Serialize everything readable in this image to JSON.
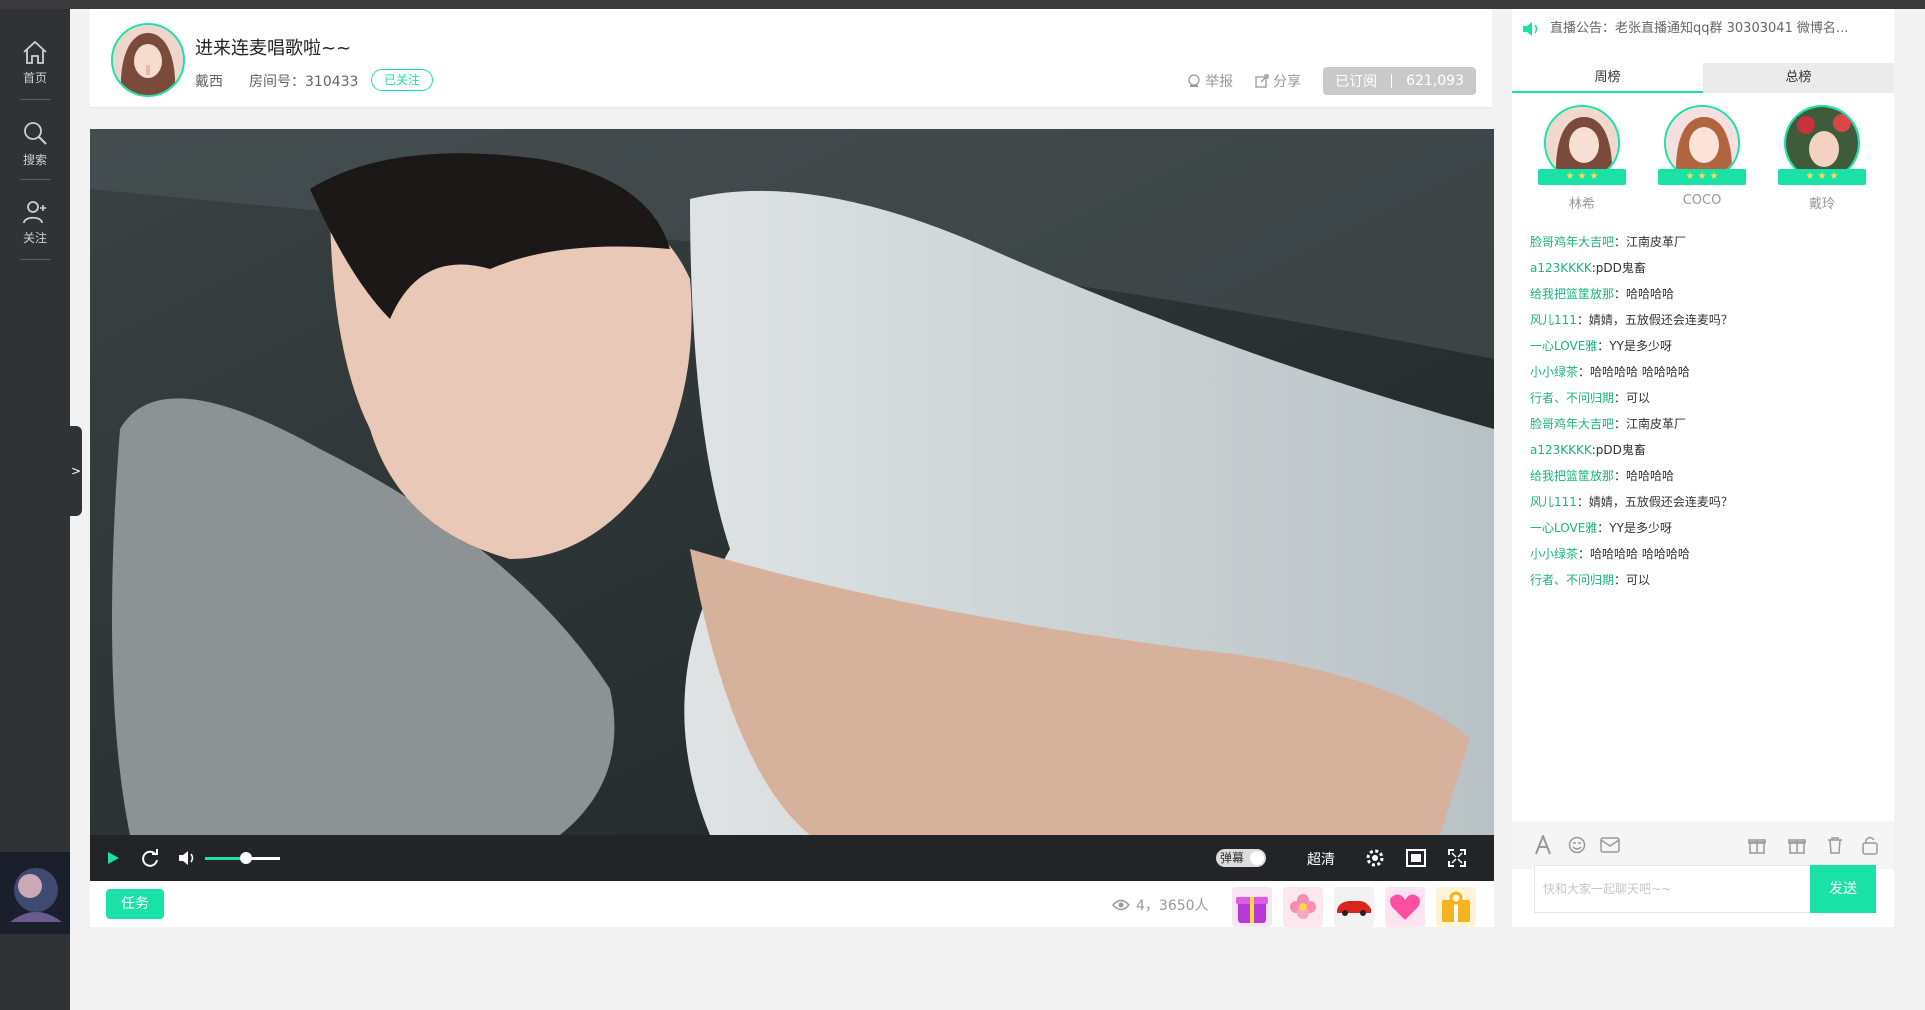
{
  "nav": {
    "home": "首页",
    "search": "搜索",
    "follow": "关注",
    "expand": ">"
  },
  "header": {
    "title": "进来连麦唱歌啦~~",
    "streamer": "戴西",
    "room": "房间号：310433",
    "follow_status": "已关注",
    "report": "举报",
    "share": "分享",
    "subscribed": "已订阅",
    "subscriber_count": "621,093"
  },
  "player": {
    "danmu": "弹幕",
    "quality": "超清",
    "volume_level": 0.55,
    "task": "任务",
    "viewers": "4，3650人"
  },
  "gifts": [
    "gift-box-icon",
    "flower-icon",
    "car-icon",
    "heart-icon",
    "present-icon"
  ],
  "panel": {
    "announcement": "直播公告：老张直播通知qq群 30303041 微博名...",
    "tabs": [
      "周榜",
      "总榜"
    ],
    "ranking": [
      {
        "name": "林希"
      },
      {
        "name": "COCO"
      },
      {
        "name": "戴玲"
      }
    ],
    "chat": [
      {
        "user": "脸哥鸡年大吉吧",
        "text": "：江南皮革厂"
      },
      {
        "user": "a123KKKK",
        "text": ":pDD鬼畜"
      },
      {
        "user": "给我把篮筐放那",
        "text": "：哈哈哈哈"
      },
      {
        "user": "风儿111",
        "text": "：婧婧，五放假还会连麦吗？"
      },
      {
        "user": "一心LOVE雅",
        "text": "：YY是多少呀"
      },
      {
        "user": "小小绿茶",
        "text": "：哈哈哈哈 哈哈哈哈"
      },
      {
        "user": "行者、不问归期",
        "text": "：可以"
      },
      {
        "user": "脸哥鸡年大吉吧",
        "text": "：江南皮革厂"
      },
      {
        "user": "a123KKKK",
        "text": ":pDD鬼畜"
      },
      {
        "user": "给我把篮筐放那",
        "text": "：哈哈哈哈"
      },
      {
        "user": "风儿111",
        "text": "：婧婧，五放假还会连麦吗？"
      },
      {
        "user": "一心LOVE雅",
        "text": "：YY是多少呀"
      },
      {
        "user": "小小绿茶",
        "text": "：哈哈哈哈 哈哈哈哈"
      },
      {
        "user": "行者、不问归期",
        "text": "：可以"
      }
    ],
    "input_placeholder": "快和大家一起聊天吧~~",
    "send": "发送"
  },
  "colors": {
    "accent": "#1ae2a7",
    "subscribed_bg": "#c9c9c9",
    "placeholder": "#c6c6c6"
  }
}
